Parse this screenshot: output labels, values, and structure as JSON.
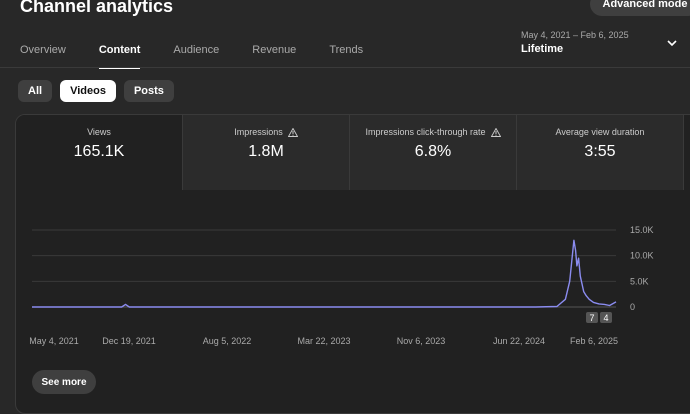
{
  "header": {
    "title": "Channel analytics",
    "advanced_mode_label": "Advanced mode"
  },
  "tabs": [
    {
      "label": "Overview",
      "active": false
    },
    {
      "label": "Content",
      "active": true
    },
    {
      "label": "Audience",
      "active": false
    },
    {
      "label": "Revenue",
      "active": false
    },
    {
      "label": "Trends",
      "active": false
    }
  ],
  "date_selector": {
    "range": "May 4, 2021 – Feb 6, 2025",
    "period": "Lifetime",
    "icon": "chevron-down-icon"
  },
  "filters": [
    {
      "label": "All",
      "active": false
    },
    {
      "label": "Videos",
      "active": true
    },
    {
      "label": "Posts",
      "active": false
    }
  ],
  "metrics": [
    {
      "label": "Views",
      "value": "165.1K",
      "warning": false,
      "active": true
    },
    {
      "label": "Impressions",
      "value": "1.8M",
      "warning": true,
      "active": false
    },
    {
      "label": "Impressions click-through rate",
      "value": "6.8%",
      "warning": true,
      "active": false
    },
    {
      "label": "Average view duration",
      "value": "3:55",
      "warning": false,
      "active": false
    }
  ],
  "see_more_label": "See more",
  "markers": [
    "7",
    "4"
  ],
  "colors": {
    "background": "#282828",
    "card": "#212121",
    "series": "#8b8cf0",
    "grid": "#3a3a3a"
  },
  "chart_data": {
    "type": "line",
    "x_tick_labels": [
      "May 4, 2021",
      "Dec 19, 2021",
      "Aug 5, 2022",
      "Mar 22, 2023",
      "Nov 6, 2023",
      "Jun 22, 2024",
      "Feb 6, 2025"
    ],
    "y_tick_labels": [
      "15.0K",
      "10.0K",
      "5.0K",
      "0"
    ],
    "ylim": [
      0,
      15000
    ],
    "grid": true,
    "series": [
      {
        "x": [
          "2021-05-04",
          "2021-12-01",
          "2021-12-10",
          "2021-12-19",
          "2022-06-01",
          "2023-01-01",
          "2024-01-01",
          "2024-08-01",
          "2024-09-20",
          "2024-10-10",
          "2024-10-20",
          "2024-10-25",
          "2024-10-30",
          "2024-11-03",
          "2024-11-06",
          "2024-11-10",
          "2024-11-14",
          "2024-11-18",
          "2024-11-22",
          "2024-11-28",
          "2024-12-05",
          "2024-12-15",
          "2024-12-28",
          "2025-01-10",
          "2025-01-22",
          "2025-02-06"
        ],
        "y": [
          0,
          0,
          500,
          0,
          0,
          0,
          0,
          0,
          100,
          1500,
          5000,
          9000,
          13000,
          11000,
          8000,
          9500,
          6000,
          4500,
          3000,
          2200,
          1500,
          900,
          600,
          500,
          300,
          1000
        ]
      }
    ]
  }
}
